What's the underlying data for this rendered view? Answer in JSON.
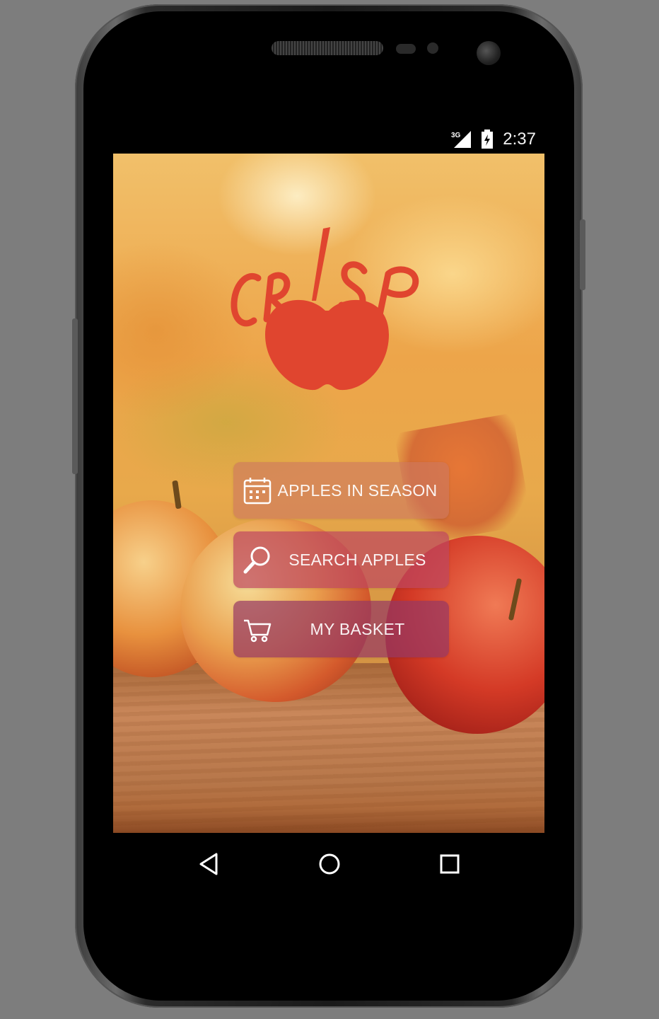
{
  "status_bar": {
    "network_label": "3G",
    "time": "2:37"
  },
  "app": {
    "logo_text": "CRISP",
    "brand_color": "#e0452f"
  },
  "menu": [
    {
      "label": "APPLES IN SEASON",
      "icon": "calendar-icon"
    },
    {
      "label": "SEARCH APPLES",
      "icon": "search-icon"
    },
    {
      "label": "MY BASKET",
      "icon": "cart-icon"
    }
  ],
  "nav_bar": {
    "buttons": [
      "back-icon",
      "home-icon",
      "recents-icon"
    ]
  }
}
